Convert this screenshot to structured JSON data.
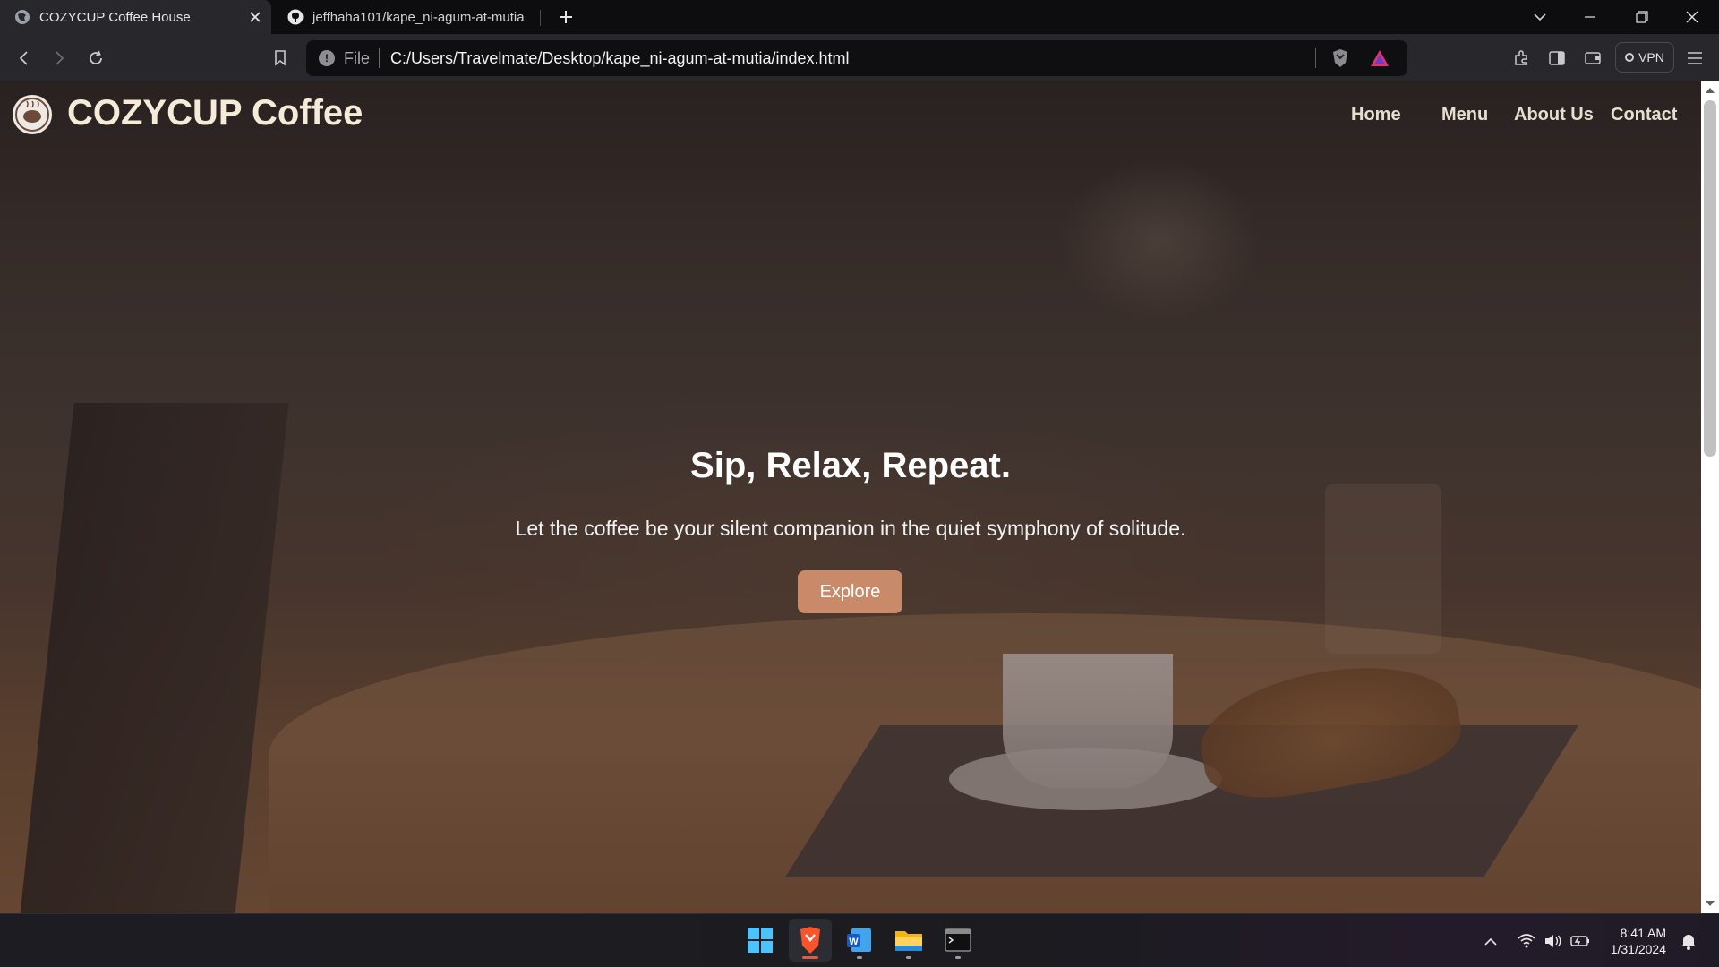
{
  "browser": {
    "tabs": [
      {
        "title": "COZYCUP Coffee House",
        "active": true,
        "icon": "globe-icon"
      },
      {
        "title": "jeffhaha101/kape_ni-agum-at-mutia",
        "active": false,
        "icon": "github-icon"
      }
    ],
    "address": {
      "scheme_label": "File",
      "url": "C:/Users/Travelmate/Desktop/kape_ni-agum-at-mutia/index.html"
    },
    "vpn_label": "VPN"
  },
  "site": {
    "brand": "COZYCUP Coffee",
    "nav": [
      {
        "label": "Home"
      },
      {
        "label": "Menu"
      },
      {
        "label": "About Us"
      },
      {
        "label": "Contact"
      }
    ],
    "hero": {
      "title": "Sip, Relax, Repeat.",
      "subtitle": "Let the coffee be your silent companion in the quiet symphony of solitude.",
      "cta": "Explore"
    },
    "colors": {
      "accent": "#c98a6a",
      "brand_text": "#f6ead8"
    }
  },
  "taskbar": {
    "apps": [
      "windows-start-icon",
      "brave-browser-icon",
      "word-icon",
      "file-explorer-icon",
      "terminal-icon"
    ],
    "time": "8:41 AM",
    "date": "1/31/2024"
  }
}
